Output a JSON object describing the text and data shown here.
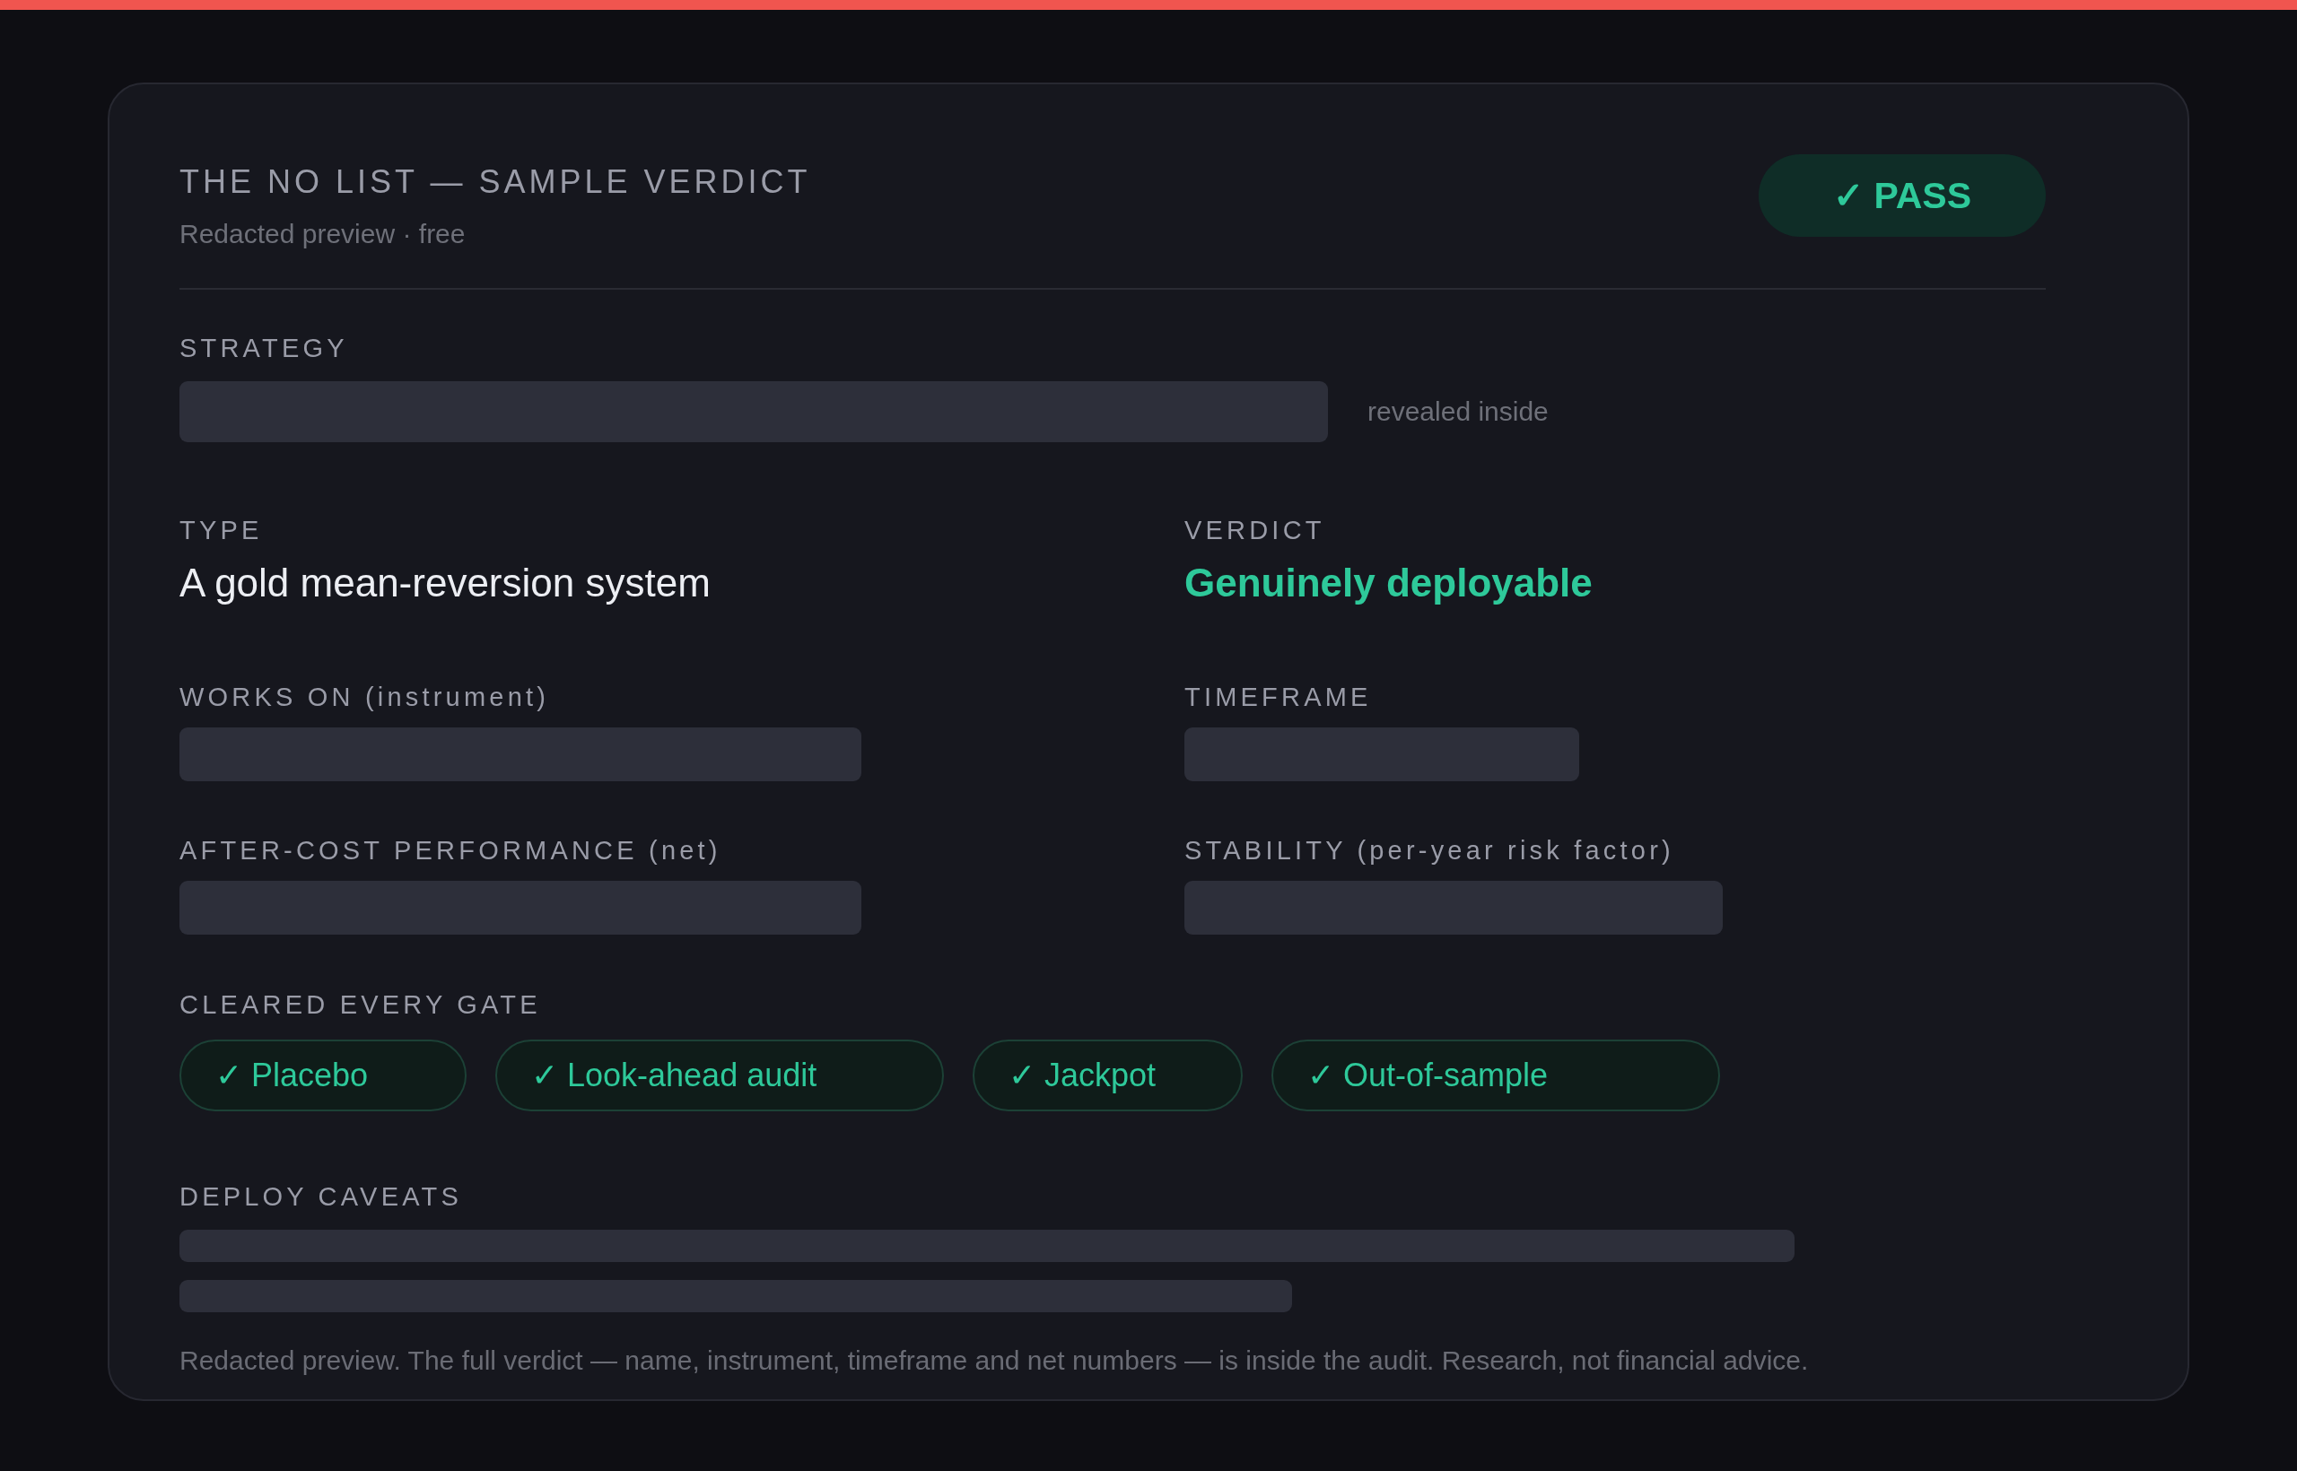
{
  "card": {
    "title": "THE NO LIST — SAMPLE VERDICT",
    "subtitle": "Redacted preview · free",
    "badge": {
      "kind": "pass",
      "label": "✓ PASS"
    }
  },
  "strategy": {
    "label": "STRATEGY",
    "note": "revealed inside"
  },
  "fields": [
    {
      "label": "TYPE",
      "kind": "text",
      "value": "A gold mean-reversion system"
    },
    {
      "label": "VERDICT",
      "kind": "verdict",
      "value": "Genuinely deployable"
    },
    {
      "label": "WORKS ON (instrument)",
      "kind": "redacted"
    },
    {
      "label": "TIMEFRAME",
      "kind": "redacted"
    },
    {
      "label": "AFTER-COST PERFORMANCE (net)",
      "kind": "redacted"
    },
    {
      "label": "STABILITY (per-year risk factor)",
      "kind": "redacted"
    }
  ],
  "gates": {
    "label": "CLEARED EVERY GATE",
    "items": [
      {
        "label": "✓ Placebo"
      },
      {
        "label": "✓ Look-ahead audit"
      },
      {
        "label": "✓ Jackpot"
      },
      {
        "label": "✓ Out-of-sample"
      }
    ]
  },
  "caveats": {
    "label": "DEPLOY CAVEATS"
  },
  "footer": "Redacted preview. The full verdict — name, instrument, timeframe and net numbers — is inside the audit. Research, not financial advice."
}
